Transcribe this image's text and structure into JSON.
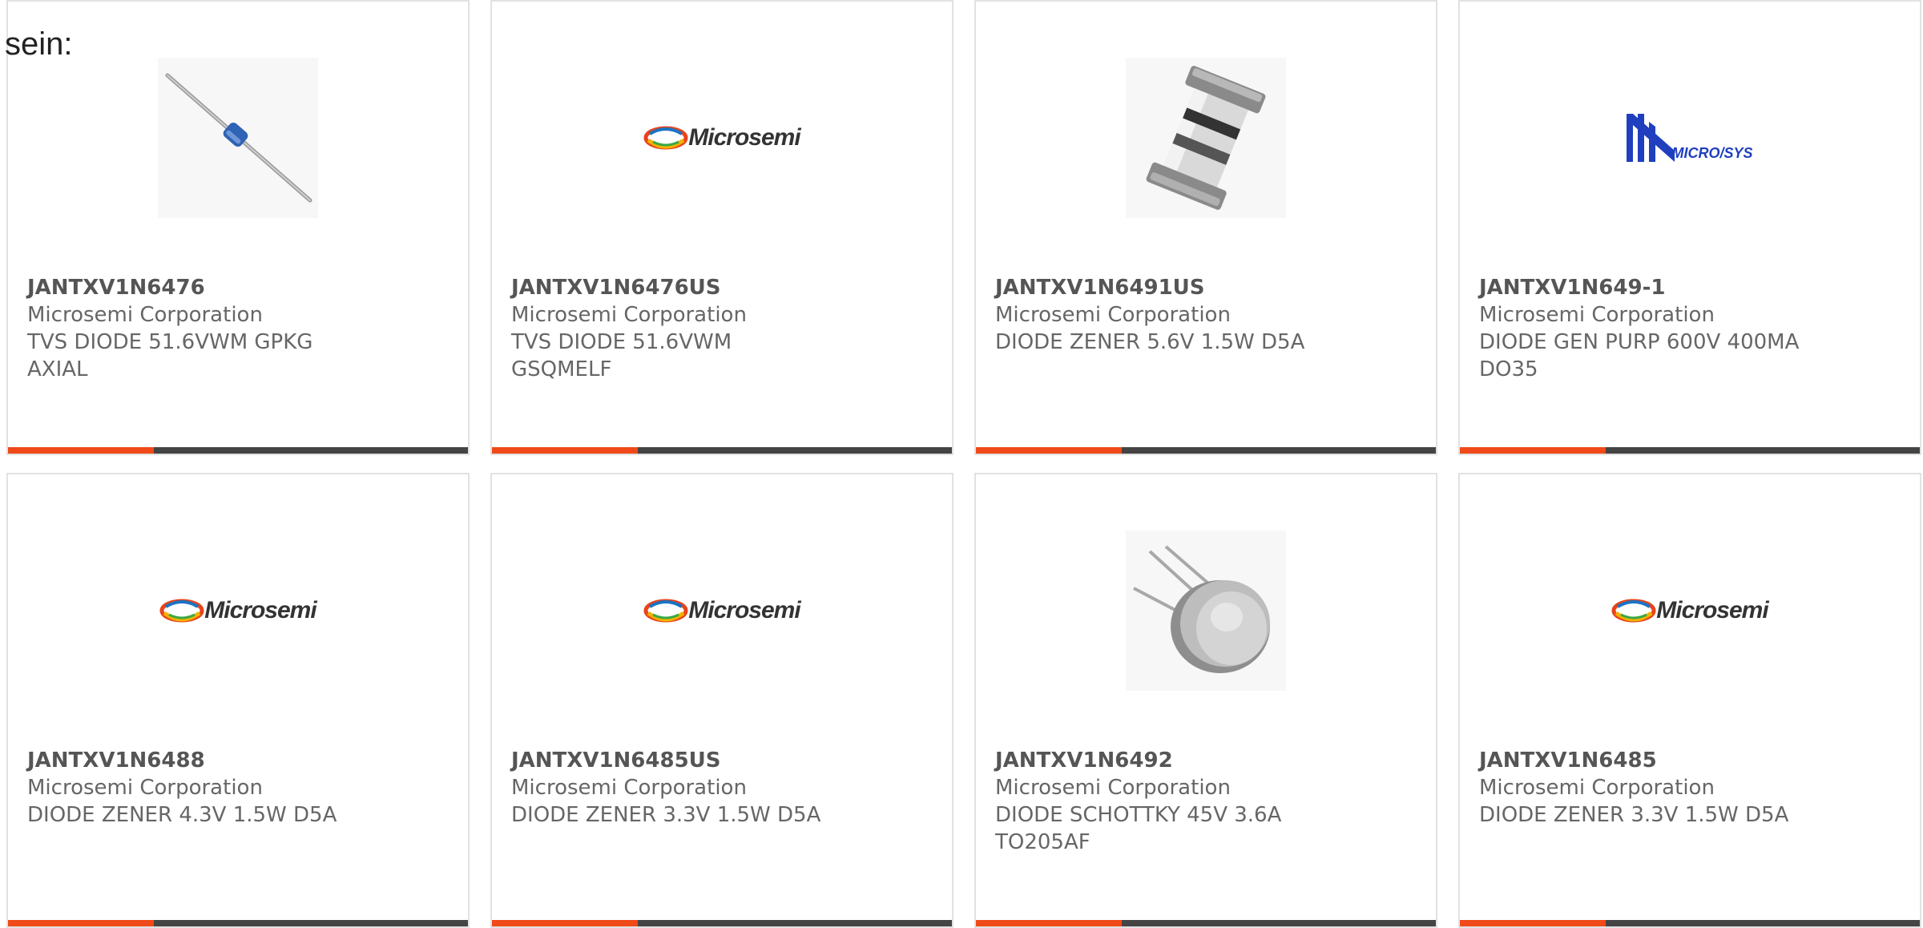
{
  "heading": "sein:",
  "colors": {
    "accent": "#f04a1a",
    "bar": "#444444",
    "border": "#e2e2e2",
    "text": "#666666"
  },
  "products": [
    {
      "part": "JANTXV1N6476",
      "manufacturer": "Microsemi Corporation",
      "description": "TVS DIODE 51.6VWM GPKG AXIAL",
      "image": "axial-diode-photo"
    },
    {
      "part": "JANTXV1N6476US",
      "manufacturer": "Microsemi Corporation",
      "description": "TVS DIODE 51.6VWM GSQMELF",
      "image": "microsemi-logo",
      "logo_text": "Microsemi"
    },
    {
      "part": "JANTXV1N6491US",
      "manufacturer": "Microsemi Corporation",
      "description": "DIODE ZENER 5.6V 1.5W D5A",
      "image": "melf-diode-photo"
    },
    {
      "part": "JANTXV1N649-1",
      "manufacturer": "Microsemi Corporation",
      "description": "DIODE GEN PURP 600V 400MA DO35",
      "image": "microsys-logo",
      "logo_text": "MICRO/SYS"
    },
    {
      "part": "JANTXV1N6488",
      "manufacturer": "Microsemi Corporation",
      "description": "DIODE ZENER 4.3V 1.5W D5A",
      "image": "microsemi-logo",
      "logo_text": "Microsemi"
    },
    {
      "part": "JANTXV1N6485US",
      "manufacturer": "Microsemi Corporation",
      "description": "DIODE ZENER 3.3V 1.5W D5A",
      "image": "microsemi-logo",
      "logo_text": "Microsemi"
    },
    {
      "part": "JANTXV1N6492",
      "manufacturer": "Microsemi Corporation",
      "description": "DIODE SCHOTTKY 45V 3.6A TO205AF",
      "image": "to-can-photo"
    },
    {
      "part": "JANTXV1N6485",
      "manufacturer": "Microsemi Corporation",
      "description": "DIODE ZENER 3.3V 1.5W D5A",
      "image": "microsemi-logo",
      "logo_text": "Microsemi"
    }
  ]
}
